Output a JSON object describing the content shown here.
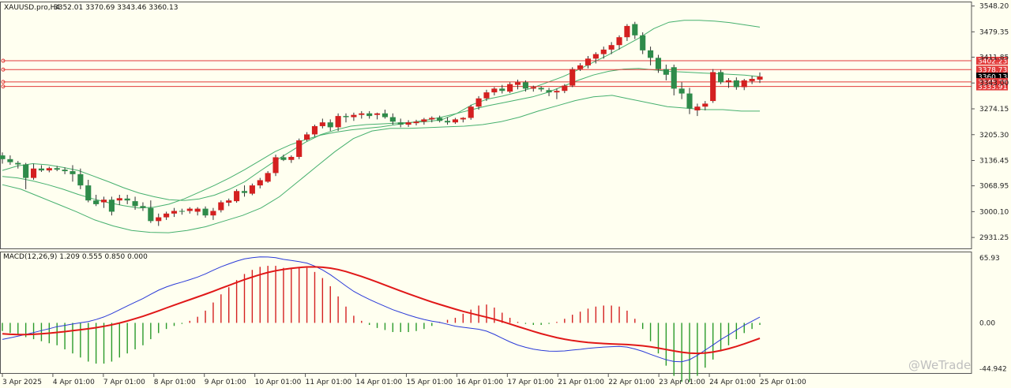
{
  "header": {
    "symbol": "XAUUSD.pro,H4",
    "ohlc": "3352.01 3370.69 3343.46 3360.13"
  },
  "macd_header": "MACD(12,26,9) 1.209 0.555 0.850 0.000",
  "watermark": "@WeTrade",
  "colors": {
    "background": "#fffff0",
    "up": "#d42020",
    "down": "#2e8b4a",
    "bands": "#46b06e",
    "level_lines": "#e23b3b",
    "macd_line": "#2a3ad8",
    "signal_line": "#e01818",
    "hist_up": "#d42020",
    "hist_down": "#2a9a2a",
    "current_price_tag": "#000000"
  },
  "chart_data": [
    {
      "type": "candlestick",
      "title": "XAUUSD.pro,H4",
      "y_ticks": [
        "3548.20",
        "3479.35",
        "3411.85",
        "3343.00",
        "3274.15",
        "3205.30",
        "3136.45",
        "3068.95",
        "3000.10",
        "2931.25"
      ],
      "ylim": [
        2900,
        3560
      ],
      "x_labels": [
        "3 Apr 2025",
        "4 Apr 01:00",
        "7 Apr 01:00",
        "8 Apr 01:00",
        "9 Apr 01:00",
        "10 Apr 01:00",
        "11 Apr 01:00",
        "14 Apr 01:00",
        "15 Apr 01:00",
        "16 Apr 01:00",
        "17 Apr 01:00",
        "21 Apr 01:00",
        "22 Apr 01:00",
        "23 Apr 01:00",
        "24 Apr 01:00",
        "25 Apr 01:00"
      ],
      "price_tags": [
        {
          "value": 3402.23,
          "label": "3402.23"
        },
        {
          "value": 3378.73,
          "label": "3378.73"
        },
        {
          "value": 3360.13,
          "label": "3360.13",
          "current": true
        },
        {
          "value": 3345.78,
          "label": "3345.78"
        },
        {
          "value": 3333.91,
          "label": "3333.91"
        }
      ],
      "candles": [
        [
          3150,
          3158,
          3128,
          3140
        ],
        [
          3140,
          3150,
          3125,
          3132
        ],
        [
          3130,
          3135,
          3115,
          3126
        ],
        [
          3126,
          3130,
          3060,
          3090
        ],
        [
          3090,
          3128,
          3085,
          3115
        ],
        [
          3115,
          3124,
          3106,
          3110
        ],
        [
          3110,
          3120,
          3105,
          3116
        ],
        [
          3116,
          3122,
          3108,
          3112
        ],
        [
          3112,
          3118,
          3100,
          3108
        ],
        [
          3108,
          3124,
          3080,
          3100
        ],
        [
          3100,
          3115,
          3060,
          3070
        ],
        [
          3070,
          3085,
          3025,
          3030
        ],
        [
          3030,
          3045,
          3015,
          3020
        ],
        [
          3025,
          3040,
          3010,
          3032
        ],
        [
          3032,
          3040,
          2990,
          3000
        ],
        [
          3030,
          3045,
          3018,
          3036
        ],
        [
          3035,
          3045,
          3020,
          3030
        ],
        [
          3028,
          3040,
          3005,
          3015
        ],
        [
          3015,
          3025,
          3002,
          3010
        ],
        [
          3010,
          3030,
          2970,
          2975
        ],
        [
          2975,
          2995,
          2962,
          2985
        ],
        [
          2985,
          3000,
          2978,
          2995
        ],
        [
          2995,
          3010,
          2986,
          3002
        ],
        [
          3002,
          3008,
          2992,
          3000
        ],
        [
          3002,
          3012,
          2995,
          3008
        ],
        [
          3000,
          3012,
          2990,
          3008
        ],
        [
          3008,
          3014,
          2984,
          2990
        ],
        [
          2990,
          3010,
          2978,
          3002
        ],
        [
          3004,
          3030,
          2998,
          3025
        ],
        [
          3024,
          3035,
          3015,
          3030
        ],
        [
          3028,
          3060,
          3024,
          3055
        ],
        [
          3055,
          3070,
          3040,
          3050
        ],
        [
          3048,
          3075,
          3044,
          3070
        ],
        [
          3070,
          3090,
          3062,
          3084
        ],
        [
          3080,
          3108,
          3077,
          3103
        ],
        [
          3103,
          3152,
          3095,
          3145
        ],
        [
          3145,
          3152,
          3135,
          3138
        ],
        [
          3138,
          3150,
          3130,
          3146
        ],
        [
          3146,
          3195,
          3140,
          3190
        ],
        [
          3192,
          3212,
          3188,
          3206
        ],
        [
          3206,
          3232,
          3200,
          3228
        ],
        [
          3228,
          3248,
          3222,
          3238
        ],
        [
          3238,
          3246,
          3215,
          3225
        ],
        [
          3225,
          3262,
          3215,
          3255
        ],
        [
          3255,
          3262,
          3238,
          3252
        ],
        [
          3252,
          3264,
          3242,
          3258
        ],
        [
          3258,
          3268,
          3248,
          3262
        ],
        [
          3262,
          3268,
          3248,
          3255
        ],
        [
          3258,
          3264,
          3246,
          3262
        ],
        [
          3262,
          3272,
          3248,
          3252
        ],
        [
          3252,
          3262,
          3232,
          3240
        ],
        [
          3238,
          3248,
          3225,
          3232
        ],
        [
          3232,
          3244,
          3226,
          3238
        ],
        [
          3236,
          3245,
          3230,
          3240
        ],
        [
          3240,
          3250,
          3232,
          3246
        ],
        [
          3246,
          3254,
          3238,
          3250
        ],
        [
          3250,
          3256,
          3238,
          3242
        ],
        [
          3242,
          3252,
          3232,
          3238
        ],
        [
          3238,
          3250,
          3234,
          3246
        ],
        [
          3246,
          3252,
          3238,
          3250
        ],
        [
          3250,
          3285,
          3245,
          3280
        ],
        [
          3280,
          3308,
          3272,
          3302
        ],
        [
          3302,
          3325,
          3295,
          3318
        ],
        [
          3318,
          3332,
          3310,
          3328
        ],
        [
          3328,
          3338,
          3315,
          3322
        ],
        [
          3320,
          3345,
          3316,
          3340
        ],
        [
          3338,
          3352,
          3326,
          3345
        ],
        [
          3345,
          3350,
          3320,
          3328
        ],
        [
          3328,
          3336,
          3320,
          3332
        ],
        [
          3330,
          3334,
          3320,
          3326
        ],
        [
          3324,
          3330,
          3308,
          3318
        ],
        [
          3318,
          3328,
          3300,
          3322
        ],
        [
          3322,
          3340,
          3316,
          3336
        ],
        [
          3336,
          3385,
          3332,
          3380
        ],
        [
          3380,
          3396,
          3375,
          3390
        ],
        [
          3390,
          3415,
          3382,
          3408
        ],
        [
          3408,
          3425,
          3395,
          3420
        ],
        [
          3420,
          3440,
          3408,
          3432
        ],
        [
          3432,
          3452,
          3420,
          3444
        ],
        [
          3444,
          3470,
          3432,
          3465
        ],
        [
          3465,
          3500,
          3455,
          3495
        ],
        [
          3500,
          3506,
          3460,
          3470
        ],
        [
          3470,
          3478,
          3420,
          3430
        ],
        [
          3430,
          3440,
          3390,
          3410
        ],
        [
          3410,
          3418,
          3370,
          3380
        ],
        [
          3380,
          3392,
          3350,
          3365
        ],
        [
          3385,
          3392,
          3310,
          3328
        ],
        [
          3328,
          3345,
          3300,
          3315
        ],
        [
          3315,
          3330,
          3260,
          3275
        ],
        [
          3270,
          3288,
          3255,
          3280
        ],
        [
          3280,
          3295,
          3270,
          3288
        ],
        [
          3295,
          3380,
          3290,
          3372
        ],
        [
          3372,
          3378,
          3340,
          3345
        ],
        [
          3345,
          3356,
          3330,
          3350
        ],
        [
          3350,
          3358,
          3325,
          3332
        ],
        [
          3332,
          3354,
          3324,
          3350
        ],
        [
          3348,
          3362,
          3340,
          3354
        ],
        [
          3352,
          3371,
          3343,
          3360
        ]
      ],
      "bands": {
        "upper": [
          3110,
          3122,
          3128,
          3125,
          3118,
          3110,
          3095,
          3080,
          3064,
          3050,
          3040,
          3032,
          3030,
          3034,
          3044,
          3060,
          3080,
          3108,
          3135,
          3160,
          3185,
          3205,
          3218,
          3228,
          3232,
          3234,
          3236,
          3238,
          3240,
          3245,
          3262,
          3285,
          3300,
          3308,
          3318,
          3330,
          3345,
          3360,
          3378,
          3398,
          3418,
          3440,
          3462,
          3488,
          3505,
          3510,
          3510,
          3508,
          3504,
          3498,
          3492
        ],
        "middle": [
          3094,
          3090,
          3082,
          3072,
          3060,
          3046,
          3034,
          3024,
          3016,
          3010,
          3012,
          3020,
          3034,
          3052,
          3070,
          3090,
          3112,
          3136,
          3160,
          3178,
          3192,
          3204,
          3212,
          3218,
          3222,
          3226,
          3232,
          3238,
          3244,
          3252,
          3262,
          3272,
          3282,
          3290,
          3298,
          3306,
          3318,
          3334,
          3350,
          3364,
          3374,
          3380,
          3382,
          3378,
          3374,
          3372,
          3370,
          3368,
          3366,
          3364,
          3360
        ],
        "lower": [
          3072,
          3060,
          3040,
          3020,
          3000,
          2978,
          2962,
          2950,
          2945,
          2944,
          2950,
          2960,
          2975,
          2990,
          3010,
          3040,
          3080,
          3120,
          3160,
          3195,
          3215,
          3222,
          3222,
          3224,
          3226,
          3228,
          3232,
          3240,
          3252,
          3268,
          3282,
          3296,
          3306,
          3310,
          3300,
          3290,
          3280,
          3276,
          3272,
          3272,
          3268,
          3268
        ]
      }
    },
    {
      "type": "macd",
      "title": "MACD(12,26,9)",
      "values": {
        "macd": 1.209,
        "signal": 0.555,
        "histogram_label": 0.85,
        "zero": 0.0
      },
      "y_ticks": [
        "65.93",
        "0.00",
        "-44.942"
      ],
      "ylim": [
        -50,
        70
      ],
      "histogram": [
        -8,
        -10,
        -12,
        -14,
        -16,
        -18,
        -20,
        -22,
        -26,
        -30,
        -34,
        -38,
        -40,
        -40,
        -38,
        -34,
        -30,
        -26,
        -22,
        -16,
        -10,
        -6,
        -3,
        -1,
        2,
        6,
        12,
        20,
        28,
        35,
        42,
        48,
        52,
        55,
        56,
        56,
        54,
        54,
        54,
        54,
        50,
        44,
        36,
        26,
        16,
        7,
        2,
        -2,
        -5,
        -7,
        -9,
        -9,
        -9,
        -8,
        -6,
        -3,
        1,
        3,
        5,
        9,
        13,
        17,
        18,
        15,
        10,
        5,
        1,
        -1,
        -2,
        -2,
        -1,
        1,
        4,
        8,
        11,
        14,
        16,
        17,
        17,
        16,
        12,
        4,
        -6,
        -18,
        -30,
        -42,
        -52,
        -58,
        -58,
        -52,
        -44,
        -36,
        -28,
        -22,
        -16,
        -10,
        -6,
        -2
      ]
    }
  ]
}
